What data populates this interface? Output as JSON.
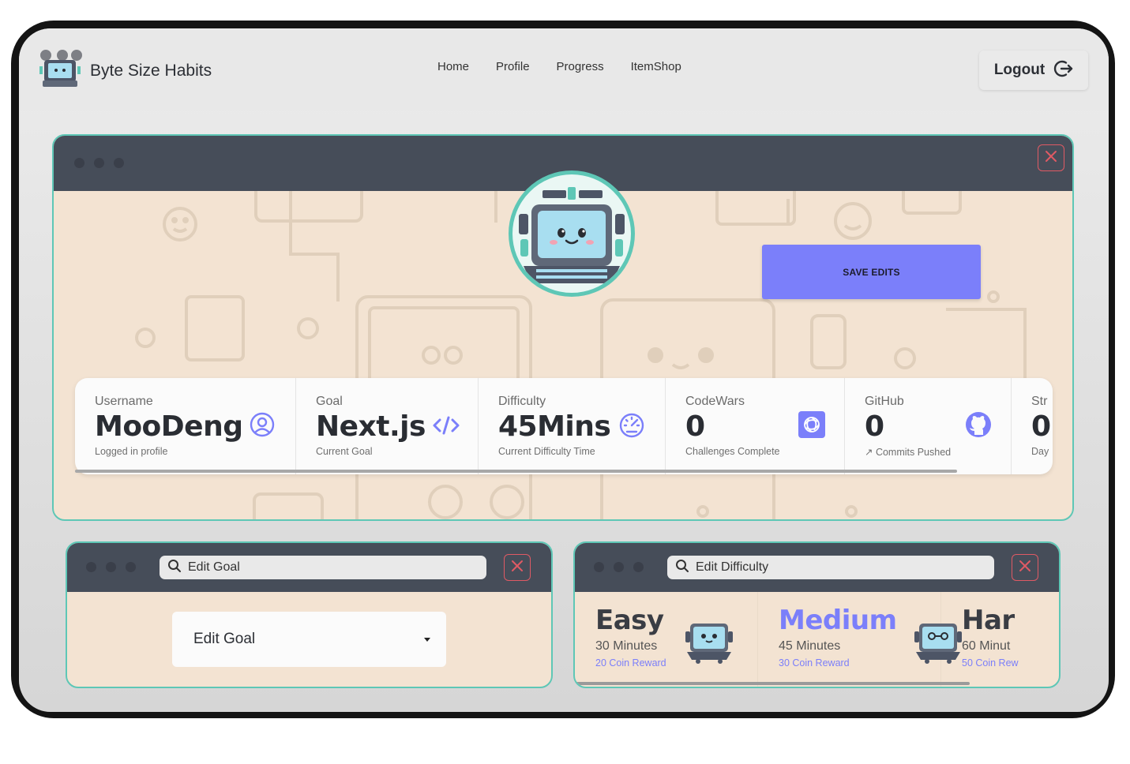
{
  "app": {
    "name": "Byte Size Habits"
  },
  "nav": {
    "links": [
      "Home",
      "Profile",
      "Progress",
      "ItemShop"
    ],
    "logout_label": "Logout"
  },
  "profile_window": {
    "save_label": "SAVE EDITS",
    "stats": [
      {
        "title": "Username",
        "value": "MooDeng",
        "desc": "Logged in profile",
        "icon": "user-circle-icon"
      },
      {
        "title": "Goal",
        "value": "Next.js",
        "desc": "Current Goal",
        "icon": "code-icon"
      },
      {
        "title": "Difficulty",
        "value": "45Mins",
        "desc": "Current Difficulty Time",
        "icon": "speedometer-icon"
      },
      {
        "title": "CodeWars",
        "value": "0",
        "desc": "Challenges Complete",
        "icon": "codewars-icon"
      },
      {
        "title": "GitHub",
        "value": "0",
        "desc": "↗ Commits Pushed",
        "icon": "github-icon"
      },
      {
        "title": "Str",
        "value": "0",
        "desc": "Day"
      }
    ]
  },
  "goal_window": {
    "search_label": "Edit Goal",
    "select_value": "Edit Goal"
  },
  "difficulty_window": {
    "search_label": "Edit Difficulty",
    "options": [
      {
        "name": "Easy",
        "time": "30 Minutes",
        "reward": "20 Coin Reward"
      },
      {
        "name": "Medium",
        "time": "45 Minutes",
        "reward": "30 Coin Reward"
      },
      {
        "name": "Har",
        "time": "60 Minut",
        "reward": "50 Coin Rew"
      }
    ],
    "selected": "Medium"
  },
  "colors": {
    "accent": "#7b7ffa",
    "border": "#5ec7b6",
    "titlebar": "#464d59",
    "panel_bg": "#f3e3d2",
    "close": "#e05a64"
  }
}
